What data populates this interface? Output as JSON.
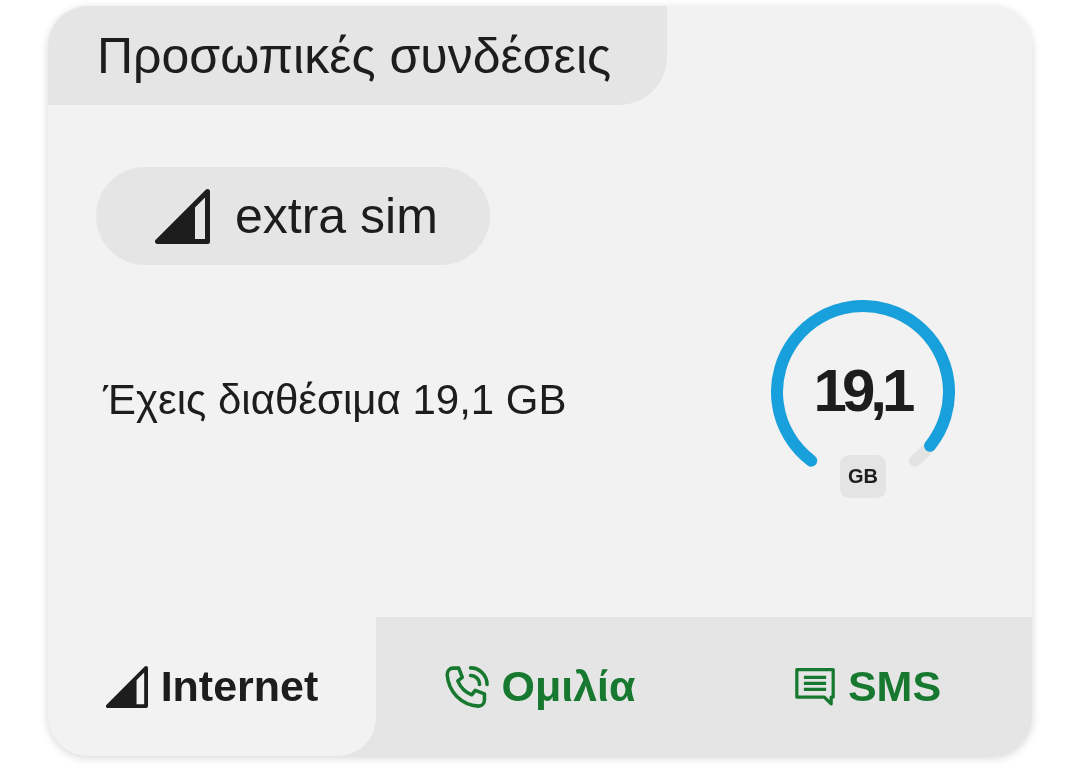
{
  "card": {
    "title": "Προσωπικές συνδέσεις"
  },
  "line": {
    "name": "extra sim"
  },
  "balance": {
    "text": "Έχεις διαθέσιμα 19,1 GB",
    "gauge": {
      "value": "19,1",
      "unit": "GB",
      "level": 0.95
    }
  },
  "tabs": [
    {
      "label": "Internet",
      "kind": "internet",
      "selected": true
    },
    {
      "label": "Ομιλία",
      "kind": "voice",
      "selected": false
    },
    {
      "label": "SMS",
      "kind": "sms",
      "selected": false
    }
  ]
}
